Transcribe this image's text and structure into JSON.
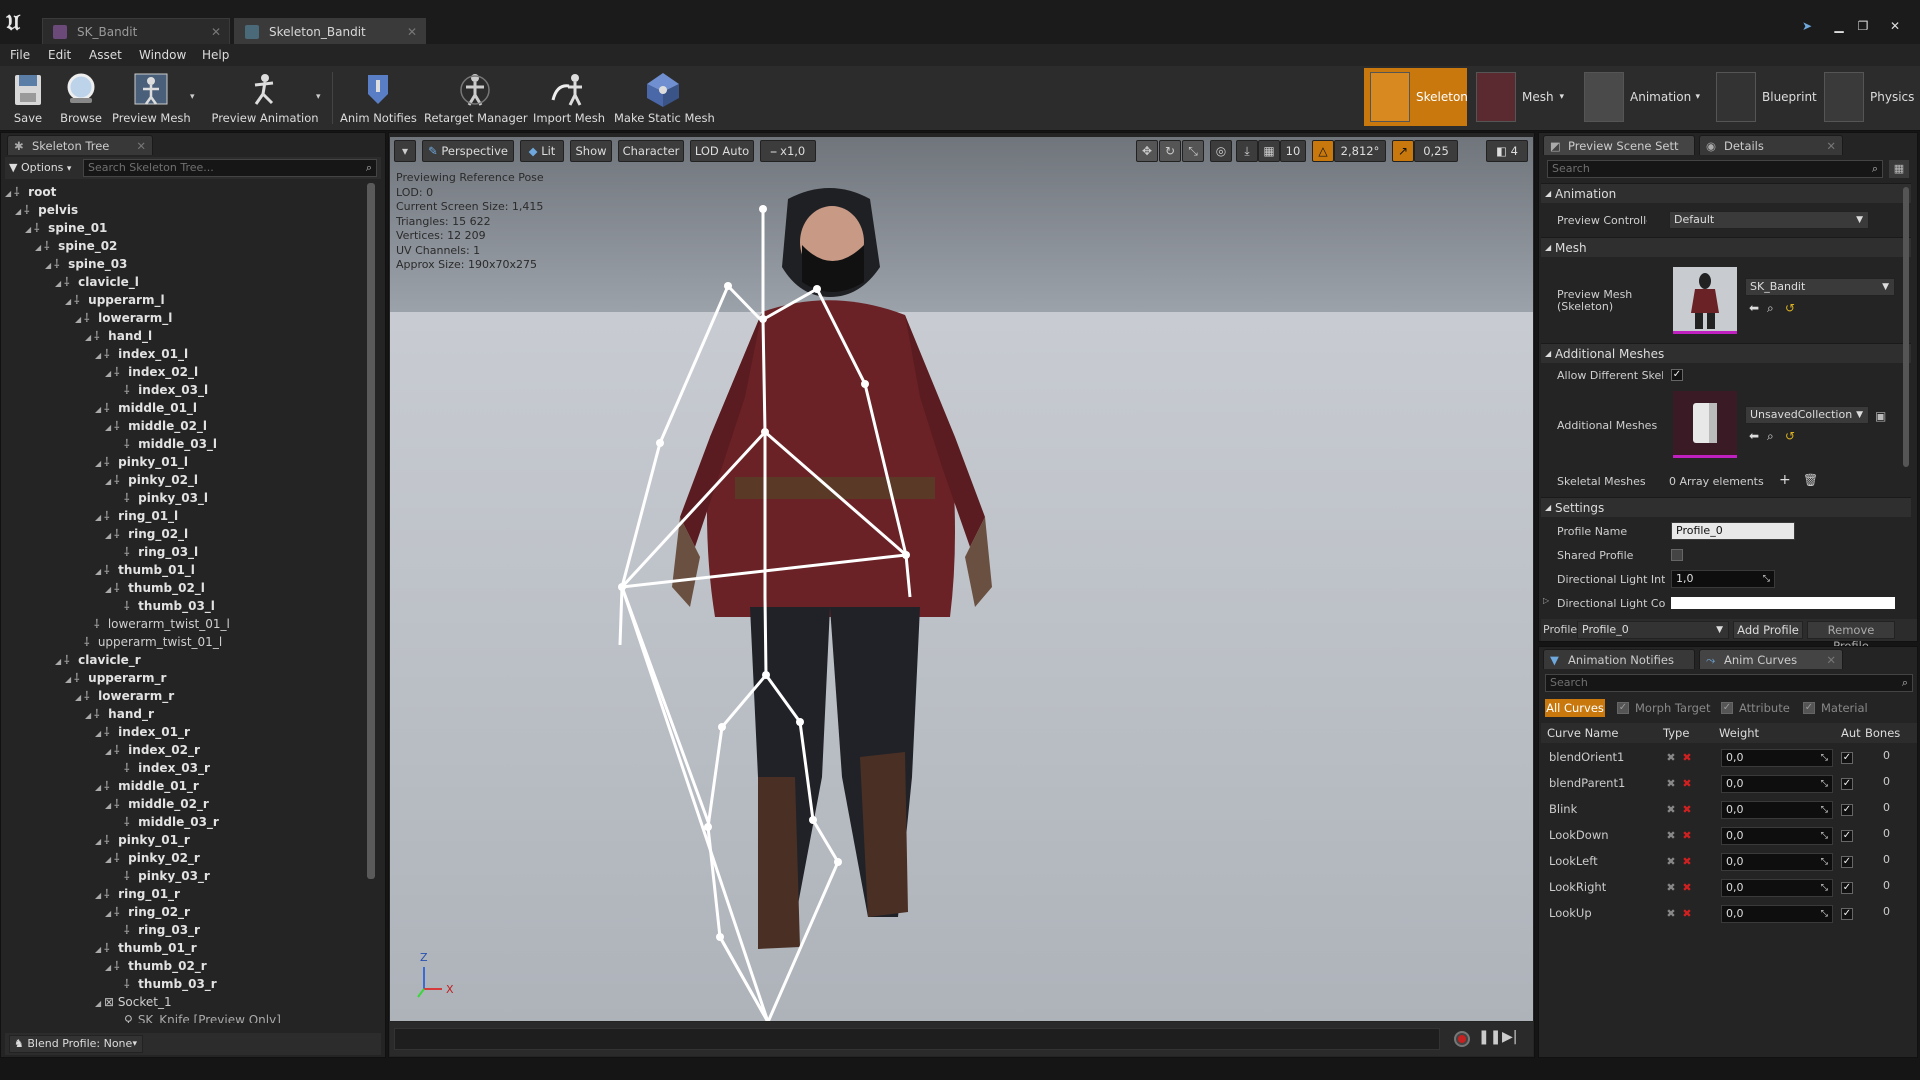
{
  "tabs": [
    {
      "label": "SK_Bandit",
      "active": false
    },
    {
      "label": "Skeleton_Bandit",
      "active": true
    }
  ],
  "menu": [
    "File",
    "Edit",
    "Asset",
    "Window",
    "Help"
  ],
  "toolbar": {
    "buttons": [
      {
        "label": "Save",
        "icon": "save-icon"
      },
      {
        "label": "Browse",
        "icon": "browse-icon"
      },
      {
        "label": "Preview Mesh",
        "icon": "preview-mesh-icon"
      },
      {
        "label": "Preview Animation",
        "icon": "preview-animation-icon"
      },
      {
        "label": "Anim Notifies",
        "icon": "anim-notifies-icon"
      },
      {
        "label": "Retarget Manager",
        "icon": "retarget-manager-icon"
      },
      {
        "label": "Import Mesh",
        "icon": "import-mesh-icon"
      },
      {
        "label": "Make Static Mesh",
        "icon": "make-static-mesh-icon"
      }
    ],
    "modes": [
      {
        "label": "Skeleton",
        "active": true
      },
      {
        "label": "Mesh",
        "active": false
      },
      {
        "label": "Animation",
        "active": false
      },
      {
        "label": "Blueprint",
        "active": false
      },
      {
        "label": "Physics",
        "active": false
      }
    ]
  },
  "skeleton_tree": {
    "tab_label": "Skeleton Tree",
    "options_label": "Options",
    "search_placeholder": "Search Skeleton Tree...",
    "rows": [
      {
        "label": "root",
        "depth": 0,
        "kind": "bone"
      },
      {
        "label": "pelvis",
        "depth": 1,
        "kind": "bone"
      },
      {
        "label": "spine_01",
        "depth": 2,
        "kind": "bone"
      },
      {
        "label": "spine_02",
        "depth": 3,
        "kind": "bone"
      },
      {
        "label": "spine_03",
        "depth": 4,
        "kind": "bone"
      },
      {
        "label": "clavicle_l",
        "depth": 5,
        "kind": "bone"
      },
      {
        "label": "upperarm_l",
        "depth": 6,
        "kind": "bone"
      },
      {
        "label": "lowerarm_l",
        "depth": 7,
        "kind": "bone"
      },
      {
        "label": "hand_l",
        "depth": 8,
        "kind": "bone"
      },
      {
        "label": "index_01_l",
        "depth": 9,
        "kind": "bone"
      },
      {
        "label": "index_02_l",
        "depth": 10,
        "kind": "bone"
      },
      {
        "label": "index_03_l",
        "depth": 11,
        "kind": "bone"
      },
      {
        "label": "middle_01_l",
        "depth": 9,
        "kind": "bone"
      },
      {
        "label": "middle_02_l",
        "depth": 10,
        "kind": "bone"
      },
      {
        "label": "middle_03_l",
        "depth": 11,
        "kind": "bone"
      },
      {
        "label": "pinky_01_l",
        "depth": 9,
        "kind": "bone"
      },
      {
        "label": "pinky_02_l",
        "depth": 10,
        "kind": "bone"
      },
      {
        "label": "pinky_03_l",
        "depth": 11,
        "kind": "bone"
      },
      {
        "label": "ring_01_l",
        "depth": 9,
        "kind": "bone"
      },
      {
        "label": "ring_02_l",
        "depth": 10,
        "kind": "bone"
      },
      {
        "label": "ring_03_l",
        "depth": 11,
        "kind": "bone"
      },
      {
        "label": "thumb_01_l",
        "depth": 9,
        "kind": "bone"
      },
      {
        "label": "thumb_02_l",
        "depth": 10,
        "kind": "bone"
      },
      {
        "label": "thumb_03_l",
        "depth": 11,
        "kind": "bone"
      },
      {
        "label": "lowerarm_twist_01_l",
        "depth": 8,
        "kind": "twist"
      },
      {
        "label": "upperarm_twist_01_l",
        "depth": 7,
        "kind": "twist"
      },
      {
        "label": "clavicle_r",
        "depth": 5,
        "kind": "bone"
      },
      {
        "label": "upperarm_r",
        "depth": 6,
        "kind": "bone"
      },
      {
        "label": "lowerarm_r",
        "depth": 7,
        "kind": "bone"
      },
      {
        "label": "hand_r",
        "depth": 8,
        "kind": "bone"
      },
      {
        "label": "index_01_r",
        "depth": 9,
        "kind": "bone"
      },
      {
        "label": "index_02_r",
        "depth": 10,
        "kind": "bone"
      },
      {
        "label": "index_03_r",
        "depth": 11,
        "kind": "bone"
      },
      {
        "label": "middle_01_r",
        "depth": 9,
        "kind": "bone"
      },
      {
        "label": "middle_02_r",
        "depth": 10,
        "kind": "bone"
      },
      {
        "label": "middle_03_r",
        "depth": 11,
        "kind": "bone"
      },
      {
        "label": "pinky_01_r",
        "depth": 9,
        "kind": "bone"
      },
      {
        "label": "pinky_02_r",
        "depth": 10,
        "kind": "bone"
      },
      {
        "label": "pinky_03_r",
        "depth": 11,
        "kind": "bone"
      },
      {
        "label": "ring_01_r",
        "depth": 9,
        "kind": "bone"
      },
      {
        "label": "ring_02_r",
        "depth": 10,
        "kind": "bone"
      },
      {
        "label": "ring_03_r",
        "depth": 11,
        "kind": "bone"
      },
      {
        "label": "thumb_01_r",
        "depth": 9,
        "kind": "bone"
      },
      {
        "label": "thumb_02_r",
        "depth": 10,
        "kind": "bone"
      },
      {
        "label": "thumb_03_r",
        "depth": 11,
        "kind": "bone"
      },
      {
        "label": "Socket_1",
        "depth": 9,
        "kind": "socket"
      },
      {
        "label": "SK_Knife  [Preview Only]",
        "depth": 11,
        "kind": "preview"
      }
    ],
    "blend_profile_label": "Blend Profile: None"
  },
  "viewport": {
    "buttons": {
      "perspective": "Perspective",
      "lit": "Lit",
      "show": "Show",
      "character": "Character",
      "lod": "LOD Auto",
      "speed": "x1,0"
    },
    "right_controls": {
      "grid_snap": "10",
      "rot_snap": "2,812°",
      "scale_snap": "0,25",
      "cam_speed": "4"
    },
    "info_lines": [
      "Previewing Reference Pose",
      "LOD: 0",
      "Current Screen Size: 1,415",
      "Triangles: 15 622",
      "Vertices: 12 209",
      "UV Channels: 1",
      "Approx Size: 190x70x275"
    ],
    "axis_z": "Z",
    "axis_x": "X"
  },
  "details": {
    "tabs": [
      {
        "label": "Preview Scene Sett",
        "active": true
      },
      {
        "label": "Details",
        "active": false
      }
    ],
    "search_placeholder": "Search",
    "sections": {
      "animation": "Animation",
      "mesh": "Mesh",
      "additional": "Additional Meshes",
      "settings": "Settings"
    },
    "preview_controller_label": "Preview Controller",
    "preview_controller_value": "Default",
    "preview_mesh_label_1": "Preview Mesh",
    "preview_mesh_label_2": "(Skeleton)",
    "preview_mesh_value": "SK_Bandit",
    "allow_diff_label": "Allow Different Skelet",
    "allow_diff_checked": true,
    "additional_meshes_label": "Additional Meshes",
    "additional_meshes_value": "UnsavedCollection",
    "skeletal_meshes_label": "Skeletal Meshes",
    "skeletal_meshes_value": "0 Array elements",
    "profile_name_label": "Profile Name",
    "profile_name_value": "Profile_0",
    "shared_profile_label": "Shared Profile",
    "shared_profile_checked": false,
    "dir_light_intensity_label": "Directional Light Inter",
    "dir_light_intensity_value": "1,0",
    "dir_light_color_label": "Directional Light Colo",
    "dir_light_color": "#ffffff",
    "profile_label": "Profile",
    "profile_value": "Profile_0",
    "add_profile": "Add Profile",
    "remove_profile": "Remove Profile"
  },
  "anim_curves": {
    "tabs": [
      {
        "label": "Animation Notifies",
        "active": false
      },
      {
        "label": "Anim Curves",
        "active": true
      }
    ],
    "search_placeholder": "Search",
    "filters": [
      {
        "label": "All Curves",
        "active": true
      },
      {
        "label": "Morph Target",
        "active": false
      },
      {
        "label": "Attribute",
        "active": false
      },
      {
        "label": "Material",
        "active": false
      }
    ],
    "columns": [
      "Curve Name",
      "Type",
      "Weight",
      "Auto",
      "Bones"
    ],
    "rows": [
      {
        "name": "blendOrient1",
        "weight": "0,0",
        "auto": true,
        "bones": "0"
      },
      {
        "name": "blendParent1",
        "weight": "0,0",
        "auto": true,
        "bones": "0"
      },
      {
        "name": "Blink",
        "weight": "0,0",
        "auto": true,
        "bones": "0"
      },
      {
        "name": "LookDown",
        "weight": "0,0",
        "auto": true,
        "bones": "0"
      },
      {
        "name": "LookLeft",
        "weight": "0,0",
        "auto": true,
        "bones": "0"
      },
      {
        "name": "LookRight",
        "weight": "0,0",
        "auto": true,
        "bones": "0"
      },
      {
        "name": "LookUp",
        "weight": "0,0",
        "auto": true,
        "bones": "0"
      }
    ]
  },
  "colors": {
    "accent": "#c8780d",
    "background": "#151515",
    "panel": "#242424"
  }
}
